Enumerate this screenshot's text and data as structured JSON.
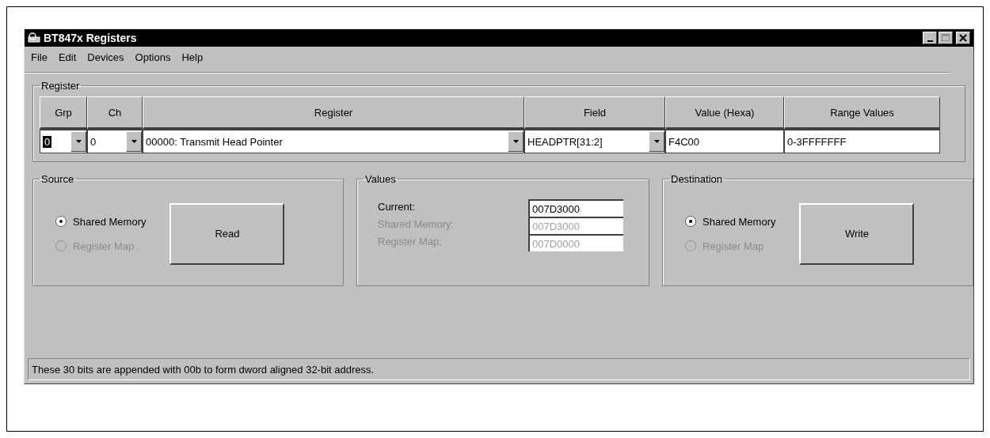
{
  "window": {
    "title": "BT847x Registers"
  },
  "menu": [
    {
      "label": "File"
    },
    {
      "label": "Edit"
    },
    {
      "label": "Devices"
    },
    {
      "label": "Options"
    },
    {
      "label": "Help"
    }
  ],
  "register_group": {
    "title": "Register",
    "columns": [
      "Grp",
      "Ch",
      "Register",
      "Field",
      "Value (Hexa)",
      "Range Values"
    ],
    "grp": "0",
    "ch": "0",
    "register": "00000: Transmit Head Pointer",
    "field": "HEADPTR[31:2]",
    "value": "F4C00",
    "range": "0-3FFFFFFF"
  },
  "source": {
    "title": "Source",
    "options": [
      {
        "label": "Shared Memory",
        "selected": true,
        "disabled": false
      },
      {
        "label": "Register Map",
        "selected": false,
        "disabled": true
      }
    ],
    "button": "Read"
  },
  "values": {
    "title": "Values",
    "rows": [
      {
        "label": "Current:",
        "value": "007D3000",
        "disabled": false
      },
      {
        "label": "Shared Memory:",
        "value": "007D3000",
        "disabled": true
      },
      {
        "label": "Register Map:",
        "value": "007D0000",
        "disabled": true
      }
    ]
  },
  "destination": {
    "title": "Destination",
    "options": [
      {
        "label": "Shared Memory",
        "selected": true,
        "disabled": false
      },
      {
        "label": "Register Map",
        "selected": false,
        "disabled": true
      }
    ],
    "button": "Write"
  },
  "status_bar": "These 30 bits are appended with 00b to form dword aligned 32-bit address."
}
